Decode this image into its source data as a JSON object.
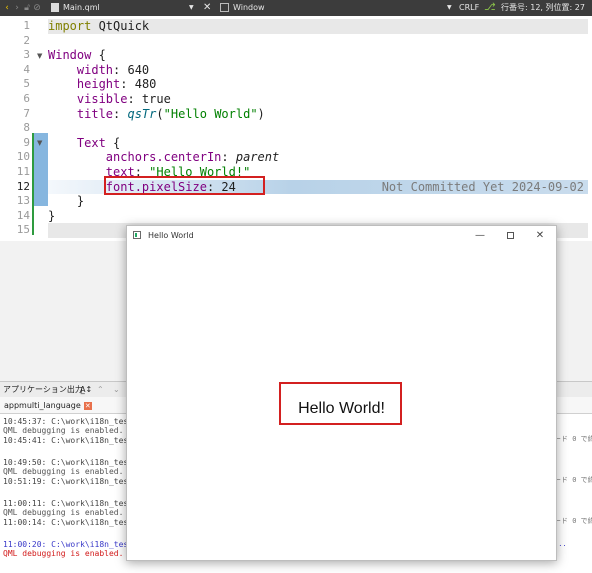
{
  "toolbar": {
    "file_name": "Main.qml",
    "symbol": "Window",
    "line_ending": "CRLF",
    "cursor_pos": "行番号: 12, 列位置: 27"
  },
  "editor": {
    "line_numbers": [
      "1",
      "2",
      "3",
      "4",
      "5",
      "6",
      "7",
      "8",
      "9",
      "10",
      "11",
      "12",
      "13",
      "14",
      "15"
    ],
    "blame_text": "Not Committed Yet 2024-09-02"
  },
  "output": {
    "pane_title": "アプリケーション出力",
    "tab_label": "appmulti_language",
    "lines": [
      "10:45:37: C:\\work\\i18n_tes",
      "QML debugging is enabled.",
      "10:45:41: C:\\work\\i18n_tes",
      "",
      "10:49:50: C:\\work\\i18n_tes",
      "QML debugging is enabled.",
      "10:51:19: C:\\work\\i18n_tes",
      "",
      "11:00:11: C:\\work\\i18n_tes",
      "QML debugging is enabled.",
      "11:00:14: C:\\work\\i18n_tes",
      "",
      "11:00:20: C:\\work\\i18n_tes",
      "QML debugging is enabled."
    ],
    "right_fragments": [
      "ード 0 で終",
      "ード 0 で終",
      "ード 0 で終",
      "..."
    ]
  },
  "window": {
    "title": "Hello World",
    "body_text": "Hello World!"
  }
}
